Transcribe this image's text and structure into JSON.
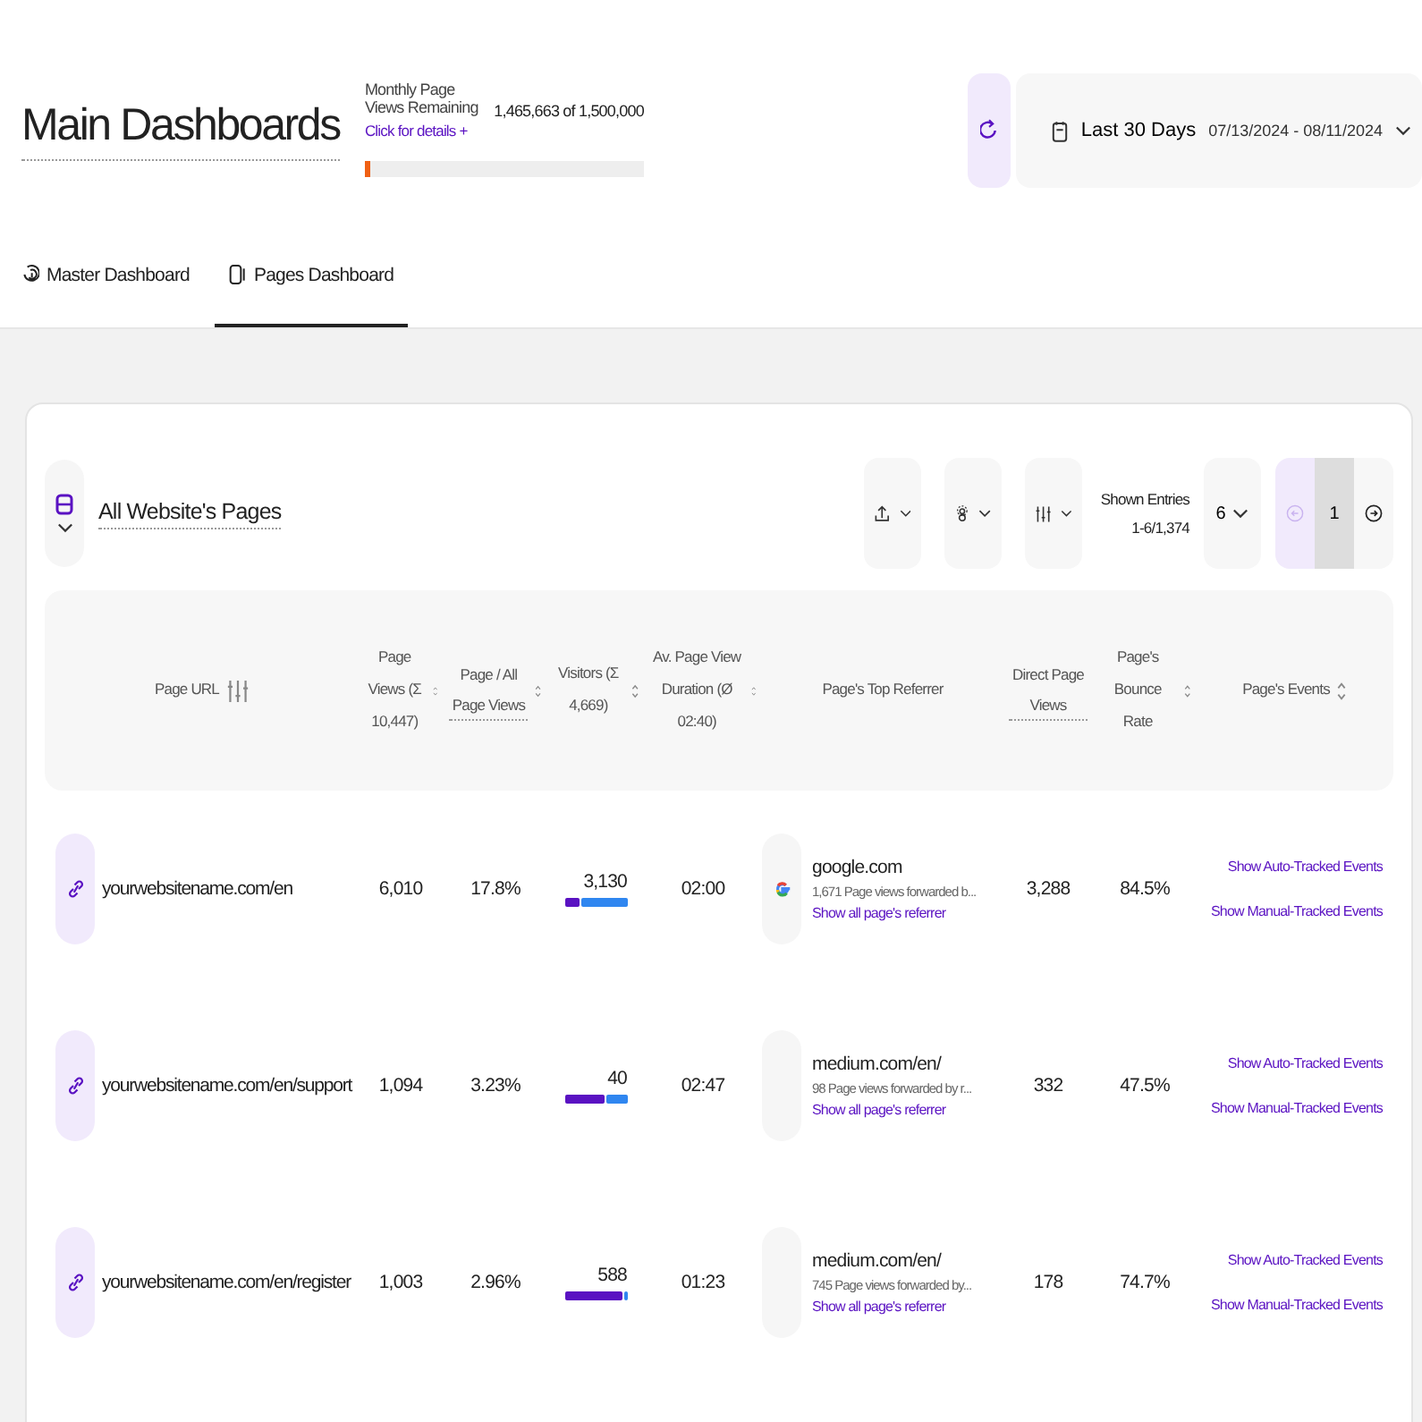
{
  "header": {
    "title": "Main Dashboards",
    "quota": {
      "label": "Monthly Page Views Remaining",
      "link": "Click for details +",
      "value": "1,465,663 of 1,500,000",
      "level": 0.02
    }
  },
  "date_range": {
    "label": "Last 30 Days",
    "dates": "07/13/2024 - 08/11/2024"
  },
  "tabs": [
    {
      "label": "Master Dashboard",
      "kind": "master",
      "selected": false
    },
    {
      "label": "Pages Dashboard",
      "kind": "pages",
      "selected": true
    }
  ],
  "card": {
    "title": "All Website's Pages",
    "shown_entries": {
      "label": "Shown Entries",
      "range": "1-6/1,374"
    },
    "page_size": "6",
    "pagination": {
      "previous_disabled": true,
      "pages": [
        {
          "label": "1",
          "selected": true
        }
      ]
    }
  },
  "columns": [
    {
      "label": "Page URL",
      "kind": "filter",
      "underlined": false
    },
    {
      "label": "Page Views (Σ 10,447)",
      "kind": "sort",
      "underlined": false
    },
    {
      "label": "Page / All Page Views",
      "kind": "sort",
      "underlined": true
    },
    {
      "label": "Visitors (Σ 4,669)",
      "kind": "sort",
      "underlined": false
    },
    {
      "label": "Av. Page View Duration (Ø 02:40)",
      "kind": "sort",
      "underlined": false
    },
    {
      "label": "Page's Top Referrer",
      "kind": "plain",
      "underlined": false
    },
    {
      "label": "Direct Page Views",
      "kind": "plain",
      "underlined": true
    },
    {
      "label": "Page's Bounce Rate",
      "kind": "sort",
      "underlined": false
    },
    {
      "label": "Page's Events",
      "kind": "sort",
      "underlined": false
    }
  ],
  "rows": [
    {
      "url": "yourwebsitename.com/en",
      "views": "6,010",
      "share": "17.8%",
      "visitors": "3,130",
      "level": 0.24,
      "duration": "02:00",
      "referrer": {
        "kind": "google",
        "name": "google.com",
        "note": "1,671 Page views forwarded b...",
        "link": "Show all page's referrer"
      },
      "direct": "3,288",
      "bounce": "84.5%",
      "events": [
        "Show Auto-Tracked Events",
        "Show Manual-Tracked Events"
      ]
    },
    {
      "url": "yourwebsitename.com/en/support",
      "views": "1,094",
      "share": "3.23%",
      "visitors": "40",
      "level": 0.64,
      "duration": "02:47",
      "referrer": {
        "kind": "blank",
        "name": "medium.com/en/",
        "note": "98 Page views forwarded by r...",
        "link": "Show all page's referrer"
      },
      "direct": "332",
      "bounce": "47.5%",
      "events": [
        "Show Auto-Tracked Events",
        "Show Manual-Tracked Events"
      ]
    },
    {
      "url": "yourwebsitename.com/en/register",
      "views": "1,003",
      "share": "2.96%",
      "visitors": "588",
      "level": 0.94,
      "duration": "01:23",
      "referrer": {
        "kind": "blank",
        "name": "medium.com/en/",
        "note": "745 Page views forwarded by...",
        "link": "Show all page's referrer"
      },
      "direct": "178",
      "bounce": "74.7%",
      "events": [
        "Show Auto-Tracked Events",
        "Show Manual-Tracked Events"
      ]
    }
  ]
}
